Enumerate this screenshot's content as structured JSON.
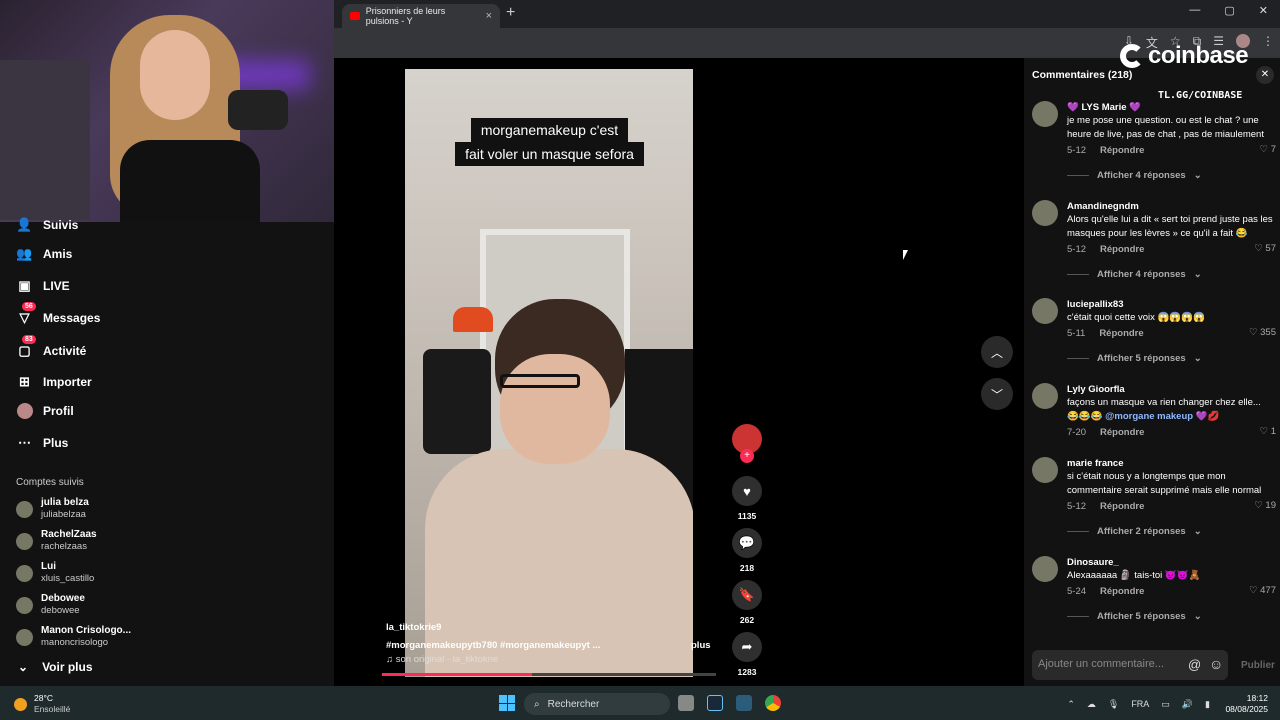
{
  "browser": {
    "tab_title": "Prisonniers de leurs pulsions - Y",
    "new_tab": "+",
    "tab_close": "×"
  },
  "left_nav": {
    "items": [
      {
        "label": "Suivis",
        "icon": "following-icon"
      },
      {
        "label": "Amis",
        "icon": "friends-icon"
      },
      {
        "label": "LIVE",
        "icon": "live-icon"
      },
      {
        "label": "Messages",
        "icon": "messages-icon",
        "badge": "56"
      },
      {
        "label": "Activité",
        "icon": "activity-icon",
        "badge": "83"
      },
      {
        "label": "Importer",
        "icon": "upload-icon"
      },
      {
        "label": "Profil",
        "icon": "profile-icon"
      },
      {
        "label": "Plus",
        "icon": "more-icon"
      }
    ],
    "followed_title": "Comptes suivis",
    "accounts": [
      {
        "name": "julia belza",
        "handle": "juliabelzaa"
      },
      {
        "name": "RachelZaas",
        "handle": "rachelzaas"
      },
      {
        "name": "Lui",
        "handle": "xluis_castillo"
      },
      {
        "name": "Debowee",
        "handle": "debowee"
      },
      {
        "name": "Manon Crisologo...",
        "handle": "manoncrisologo"
      }
    ],
    "see_more": "Voir plus"
  },
  "video": {
    "caption_line1": "morganemakeup c'est",
    "caption_line2": "fait voler un masque sefora",
    "username": "la_tiktokrie9",
    "tags": "#morganemakeupytb780  #morganemakeupyt  ...",
    "more": "plus",
    "sound": "son original - la_tiktokrie",
    "progress": 0.45,
    "likes": "1135",
    "comments": "218",
    "saves": "262",
    "shares": "1283"
  },
  "overlay": {
    "brand": "coinbase",
    "url": "TL.GG/COINBASE"
  },
  "comments": {
    "title": "Commentaires (218)",
    "reply_label": "Répondre",
    "input_placeholder": "Ajouter un commentaire...",
    "publish": "Publier",
    "items": [
      {
        "user": "💜 LYS Marie 💜",
        "text": "je me pose une question. ou est le chat ? une heure de live, pas de chat , pas de miaulement",
        "date": "5-12",
        "likes": "7",
        "replies": "Afficher 4 réponses"
      },
      {
        "user": "Amandinegndm",
        "text": "Alors qu'elle lui a dit « sert toi prend juste pas les masques pour les lèvres » ce qu'il a fait 😂",
        "date": "5-12",
        "likes": "57",
        "replies": "Afficher 4 réponses"
      },
      {
        "user": "luciepallix83",
        "text": "c'était quoi cette voix 😱😱😱😱",
        "date": "5-11",
        "likes": "355",
        "replies": "Afficher 5 réponses"
      },
      {
        "user": "Lyly Gioorfla",
        "text": "façons un masque va rien changer chez elle...",
        "text2": "😂😂😂",
        "mention": "@morgane makeup",
        "date": "7-20",
        "likes": "1",
        "replies": ""
      },
      {
        "user": "marie france",
        "text": "si c'était nous y a longtemps que mon commentaire serait supprimé mais elle normal",
        "date": "5-12",
        "likes": "19",
        "replies": "Afficher 2 réponses"
      },
      {
        "user": "Dinosaure_",
        "text": "Alexaaaaaa 🗿 tais-toi 👿👿🧸",
        "date": "5-24",
        "likes": "477",
        "replies": "Afficher 5 réponses"
      }
    ]
  },
  "taskbar": {
    "temp": "28°C",
    "weather": "Ensoleillé",
    "search": "Rechercher",
    "lang": "FRA",
    "time": "18:12",
    "date": "08/08/2025"
  }
}
